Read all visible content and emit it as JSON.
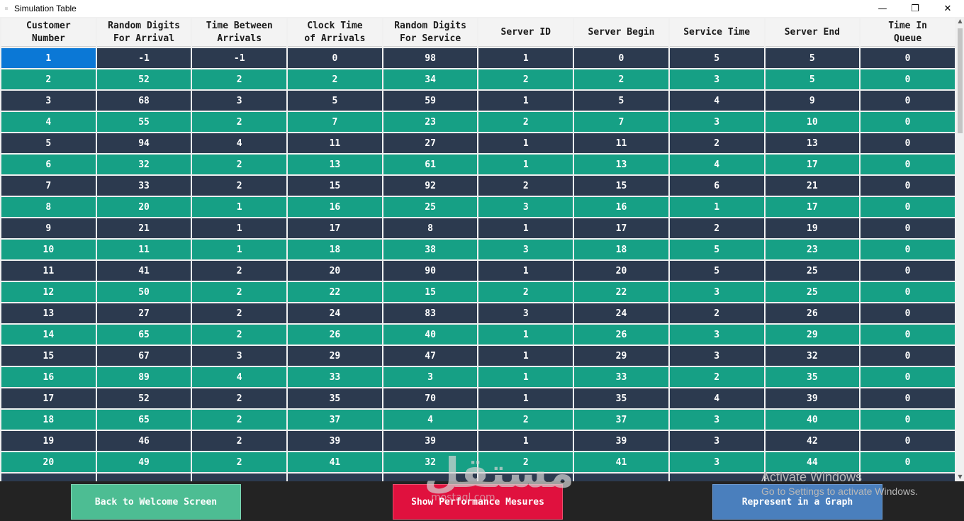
{
  "window": {
    "title": "Simulation Table",
    "buttons": {
      "minimize": "—",
      "restore": "❐",
      "close": "✕"
    }
  },
  "table": {
    "columns": [
      "Customer Number",
      "Random Digits For Arrival",
      "Time Between Arrivals",
      "Clock Time of Arrivals",
      "Random Digits For Service",
      "Server ID",
      "Server Begin",
      "Service Time",
      "Server End",
      "Time In Queue"
    ],
    "rows": [
      [
        "1",
        "-1",
        "-1",
        "0",
        "98",
        "1",
        "0",
        "5",
        "5",
        "0"
      ],
      [
        "2",
        "52",
        "2",
        "2",
        "34",
        "2",
        "2",
        "3",
        "5",
        "0"
      ],
      [
        "3",
        "68",
        "3",
        "5",
        "59",
        "1",
        "5",
        "4",
        "9",
        "0"
      ],
      [
        "4",
        "55",
        "2",
        "7",
        "23",
        "2",
        "7",
        "3",
        "10",
        "0"
      ],
      [
        "5",
        "94",
        "4",
        "11",
        "27",
        "1",
        "11",
        "2",
        "13",
        "0"
      ],
      [
        "6",
        "32",
        "2",
        "13",
        "61",
        "1",
        "13",
        "4",
        "17",
        "0"
      ],
      [
        "7",
        "33",
        "2",
        "15",
        "92",
        "2",
        "15",
        "6",
        "21",
        "0"
      ],
      [
        "8",
        "20",
        "1",
        "16",
        "25",
        "3",
        "16",
        "1",
        "17",
        "0"
      ],
      [
        "9",
        "21",
        "1",
        "17",
        "8",
        "1",
        "17",
        "2",
        "19",
        "0"
      ],
      [
        "10",
        "11",
        "1",
        "18",
        "38",
        "3",
        "18",
        "5",
        "23",
        "0"
      ],
      [
        "11",
        "41",
        "2",
        "20",
        "90",
        "1",
        "20",
        "5",
        "25",
        "0"
      ],
      [
        "12",
        "50",
        "2",
        "22",
        "15",
        "2",
        "22",
        "3",
        "25",
        "0"
      ],
      [
        "13",
        "27",
        "2",
        "24",
        "83",
        "3",
        "24",
        "2",
        "26",
        "0"
      ],
      [
        "14",
        "65",
        "2",
        "26",
        "40",
        "1",
        "26",
        "3",
        "29",
        "0"
      ],
      [
        "15",
        "67",
        "3",
        "29",
        "47",
        "1",
        "29",
        "3",
        "32",
        "0"
      ],
      [
        "16",
        "89",
        "4",
        "33",
        "3",
        "1",
        "33",
        "2",
        "35",
        "0"
      ],
      [
        "17",
        "52",
        "2",
        "35",
        "70",
        "1",
        "35",
        "4",
        "39",
        "0"
      ],
      [
        "18",
        "65",
        "2",
        "37",
        "4",
        "2",
        "37",
        "3",
        "40",
        "0"
      ],
      [
        "19",
        "46",
        "2",
        "39",
        "39",
        "1",
        "39",
        "3",
        "42",
        "0"
      ],
      [
        "20",
        "49",
        "2",
        "41",
        "32",
        "2",
        "41",
        "3",
        "44",
        "0"
      ],
      [
        "",
        "",
        "",
        "",
        "",
        "",
        "",
        "",
        "",
        ""
      ]
    ]
  },
  "colors": {
    "row_dark": "#2c3a4f",
    "row_teal": "#16a085",
    "selected": "#0b78d6",
    "back_button": "#4dbd93",
    "performance_button": "#e0113e",
    "graph_button": "#4a7fbd"
  },
  "actions": {
    "back_label": "Back to Welcome Screen",
    "performance_label": "Show Performance Mesures",
    "graph_label": "Represent in a Graph"
  },
  "overlay": {
    "watermark_logo_text": "مستقل",
    "watermark_sub": "mostaql.com",
    "activate_title": "Activate Windows",
    "activate_sub": "Go to Settings to activate Windows."
  }
}
